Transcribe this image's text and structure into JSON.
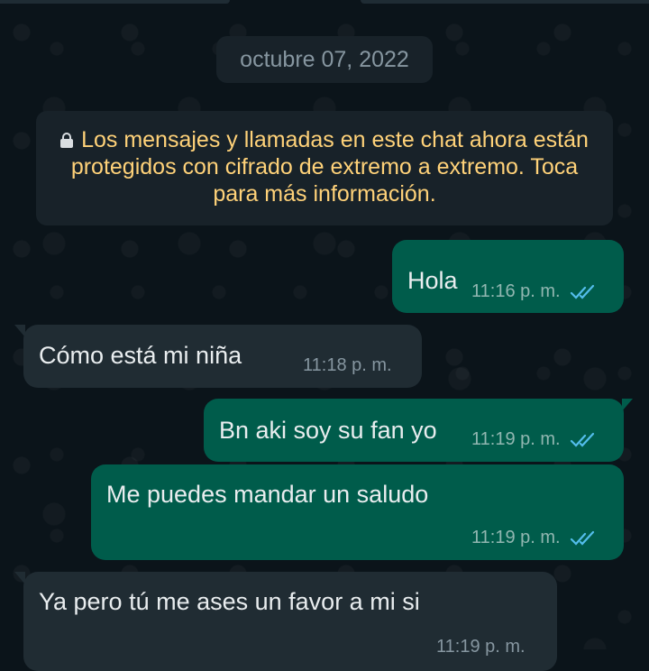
{
  "chat": {
    "date_chip": "octubre 07, 2022",
    "encryption_notice": "Los mensajes y llamadas en este chat ahora están protegidos con cifrado de extremo a extremo. Toca para más información.",
    "messages": [
      {
        "direction": "outgoing",
        "text": "Hola",
        "time": "11:16 p. m.",
        "status": "read-ticks-icon"
      },
      {
        "direction": "incoming",
        "text": "Cómo está mi niña",
        "time": "11:18 p. m."
      },
      {
        "direction": "outgoing",
        "text": "Bn aki soy su fan yo",
        "time": "11:19 p. m.",
        "status": "read-ticks-icon"
      },
      {
        "direction": "outgoing",
        "text": "Me puedes mandar un saludo",
        "time": "11:19 p. m.",
        "status": "read-ticks-icon"
      },
      {
        "direction": "incoming",
        "text": "Ya pero tú me ases un favor a mi si",
        "time": "11:19 p. m."
      }
    ]
  },
  "colors": {
    "background": "#0b141a",
    "outgoing_bubble": "#005c4b",
    "incoming_bubble": "#202c33",
    "system_chip": "#182229",
    "notice_text": "#ffd279",
    "read_ticks": "#53bdeb"
  },
  "icons": {
    "lock": "lock-icon",
    "read_status": "read-ticks-icon"
  }
}
